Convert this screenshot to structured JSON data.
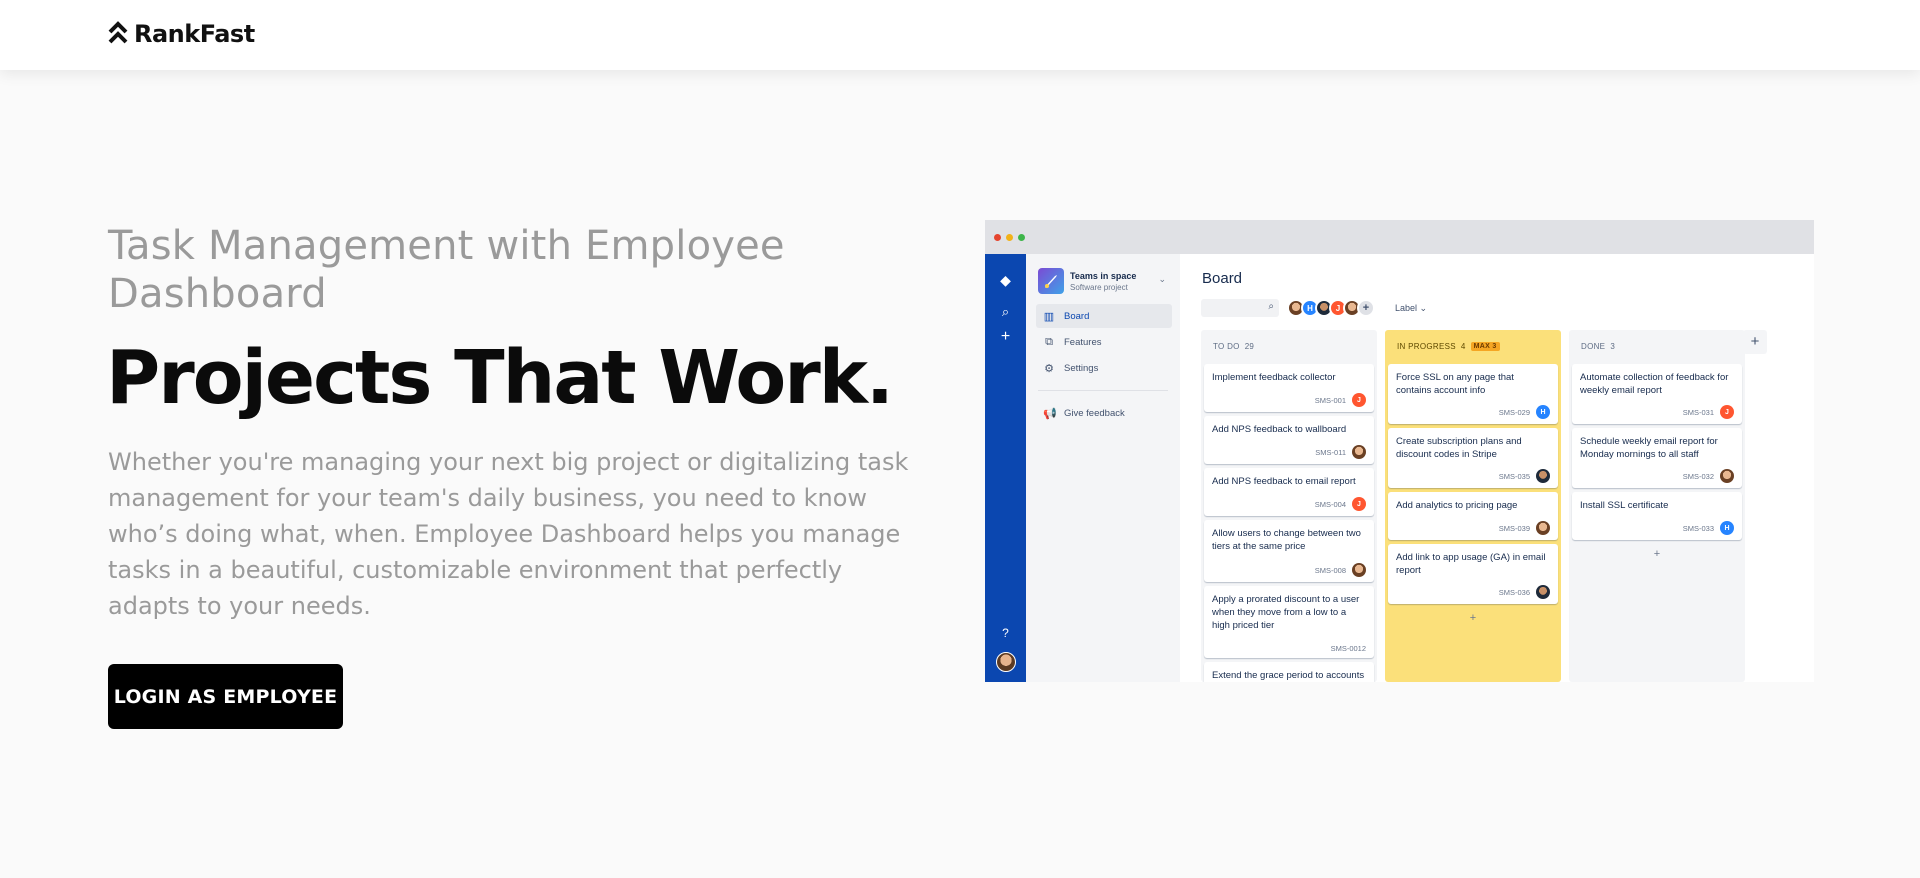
{
  "header": {
    "brand": "RankFast"
  },
  "hero": {
    "eyebrow": "Task Management with Employee Dashboard",
    "headline": "Projects That Work.",
    "lead": "Whether you're managing your next big project or digitalizing task management for your team's daily business, you need to know who’s doing what, when. Employee Dashboard helps you manage tasks in a beautiful, customizable environment that perfectly adapts to your needs.",
    "cta_label": "LOGIN AS EMPLOYEE"
  },
  "colors": {
    "cta_bg": "#000000",
    "rail": "#0b47b0",
    "in_progress": "#fbe07a"
  },
  "mock": {
    "project_name": "Teams in space",
    "project_type": "Software project",
    "nav": [
      "Board",
      "Features",
      "Settings"
    ],
    "feedback": "Give feedback",
    "board_title": "Board",
    "label_filter": "Label",
    "columns": [
      {
        "title": "TO DO",
        "count": "29",
        "cards": [
          {
            "title": "Implement feedback collector",
            "key": "SMS-001",
            "assignee": "J"
          },
          {
            "title": "Add NPS feedback to wallboard",
            "key": "SMS-011",
            "assignee": ""
          },
          {
            "title": "Add NPS feedback to email report",
            "key": "SMS-004",
            "assignee": "J"
          },
          {
            "title": "Allow users to change between two tiers at the same price",
            "key": "SMS-008",
            "assignee": ""
          },
          {
            "title": "Apply a prorated discount to a user when they move from a low to a high priced tier",
            "key": "SMS-0012",
            "assignee": ""
          },
          {
            "title": "Extend the grace period to accounts",
            "key": "",
            "assignee": ""
          }
        ]
      },
      {
        "title": "IN PROGRESS",
        "count": "4",
        "badge": "MAX 3",
        "cards": [
          {
            "title": "Force SSL on any page that contains account info",
            "key": "SMS-029",
            "assignee": "H"
          },
          {
            "title": "Create subscription plans and discount codes in Stripe",
            "key": "SMS-035",
            "assignee": ""
          },
          {
            "title": "Add analytics to pricing page",
            "key": "SMS-039",
            "assignee": ""
          },
          {
            "title": "Add link to app usage (GA) in email report",
            "key": "SMS-036",
            "assignee": ""
          }
        ]
      },
      {
        "title": "DONE",
        "count": "3",
        "cards": [
          {
            "title": "Automate collection of feedback for weekly email report",
            "key": "SMS-031",
            "assignee": "J"
          },
          {
            "title": "Schedule weekly email report for Monday mornings to all staff",
            "key": "SMS-032",
            "assignee": ""
          },
          {
            "title": "Install SSL certificate",
            "key": "SMS-033",
            "assignee": "H"
          }
        ]
      }
    ]
  }
}
